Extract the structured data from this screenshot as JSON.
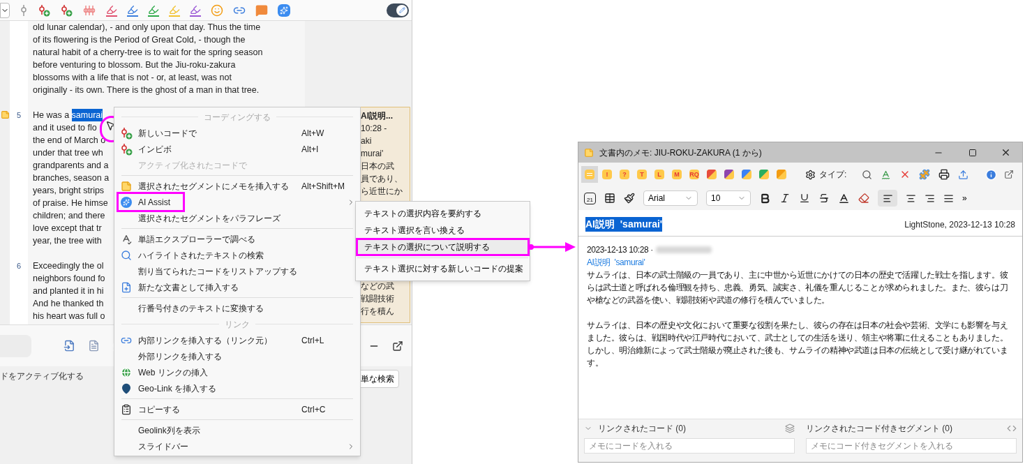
{
  "toolbar": {
    "tools": [
      {
        "kind": "dropdown"
      },
      {
        "kind": "pin"
      },
      {
        "kind": "code-add"
      },
      {
        "kind": "code-add"
      },
      {
        "kind": "codes"
      },
      {
        "kind": "marker",
        "color": "#e0506e"
      },
      {
        "kind": "marker",
        "color": "#3b7ddd"
      },
      {
        "kind": "marker",
        "color": "#2eaa4a"
      },
      {
        "kind": "marker",
        "color": "#f2c230"
      },
      {
        "kind": "marker",
        "color": "#9b59d6"
      },
      {
        "kind": "emoji"
      },
      {
        "kind": "link"
      },
      {
        "kind": "comment"
      },
      {
        "kind": "ai"
      }
    ],
    "edit_mode": {
      "on": true
    }
  },
  "document": {
    "paragraphs": [
      {
        "lines": [
          "old lunar calendar), - and only upon that day. Thus the time",
          "of its flowering is the Period of Great Cold, - though the",
          "natural habit of a cherry-tree is to wait for the spring season",
          "before venturing to blossom. But the Jiu-roku-zakura",
          "blossoms with a life that is not - or, at least, was not",
          "originally - its own. There is the ghost of a man in that tree."
        ]
      },
      {
        "number": "5",
        "lines": [
          [
            {
              "text": "He was a ",
              "selected": false
            },
            {
              "text": "samurai",
              "selected": true
            }
          ],
          "and it used to flo",
          "the end of March o",
          "under that tree wh",
          "grandparents and a",
          "branches, season a",
          "years, bright strips",
          "of praise. He himse",
          "children; and there",
          "love except that tr",
          "year, the tree with"
        ],
        "memo": true
      },
      {
        "number": "6",
        "lines": [
          "Exceedingly the ol",
          "neighbors found fo",
          "and planted it in hi",
          "And he thanked th",
          "his heart was full o"
        ]
      }
    ],
    "memo_strip": {
      "title": "AI説明...",
      "lines_top": [
        "10:28 -",
        "aki",
        "murai'",
        "日本の武",
        "員であり、",
        "ら近世にか"
      ],
      "lines_bottom": [
        "などの武",
        "戦闘技術",
        "行を積ん"
      ]
    }
  },
  "bottom_panel": {
    "tools": [
      {
        "kind": "import"
      },
      {
        "kind": "favorite"
      },
      {
        "kind": "comment"
      }
    ],
    "label": "ドをアクティブ化する",
    "button": "単な検索"
  },
  "context_menu": {
    "items": [
      {
        "kind": "header",
        "label": "コーディングする"
      },
      {
        "kind": "item",
        "label": "新しいコードで",
        "shortcut": "Alt+W",
        "disabled": false,
        "submenu": false,
        "annotated": false
      },
      {
        "kind": "item",
        "label": "インビボ",
        "shortcut": "Alt+I",
        "disabled": false,
        "submenu": false,
        "annotated": false
      },
      {
        "kind": "item",
        "label": "アクティブ化されたコードで",
        "disabled": true,
        "submenu": false,
        "annotated": false
      },
      {
        "kind": "separator"
      },
      {
        "kind": "item",
        "label": "選択されたセグメントにメモを挿入する",
        "shortcut": "Alt+Shift+M",
        "disabled": false,
        "submenu": false,
        "annotated": false
      },
      {
        "kind": "item",
        "label": "AI Assist",
        "disabled": false,
        "submenu": true,
        "annotated": true
      },
      {
        "kind": "item",
        "label": "選択されたセグメントをパラフレーズ",
        "disabled": false,
        "submenu": false,
        "annotated": false
      },
      {
        "kind": "separator"
      },
      {
        "kind": "item",
        "label": "単語エクスプローラーで調べる",
        "disabled": false,
        "submenu": false,
        "annotated": false
      },
      {
        "kind": "item",
        "label": "ハイライトされたテキストの検索",
        "disabled": false,
        "submenu": false,
        "annotated": false
      },
      {
        "kind": "item",
        "label": "割り当てられたコードをリストアップする",
        "disabled": false,
        "submenu": false,
        "annotated": false
      },
      {
        "kind": "item",
        "label": "新たな文書として挿入する",
        "disabled": false,
        "submenu": false,
        "annotated": false
      },
      {
        "kind": "separator"
      },
      {
        "kind": "item",
        "label": "行番号付きのテキストに変換する",
        "disabled": false,
        "submenu": false,
        "annotated": false
      },
      {
        "kind": "header",
        "label": "リンク"
      },
      {
        "kind": "item",
        "label": "内部リンクを挿入する（リンク元）",
        "shortcut": "Ctrl+L",
        "disabled": false,
        "submenu": false,
        "annotated": false
      },
      {
        "kind": "item",
        "label": "外部リンクを挿入する",
        "disabled": false,
        "submenu": false,
        "annotated": false
      },
      {
        "kind": "item",
        "label": "Web リンクの挿入",
        "disabled": false,
        "submenu": false,
        "annotated": false
      },
      {
        "kind": "item",
        "label": "Geo-Link を挿入する",
        "disabled": false,
        "submenu": false,
        "annotated": false
      },
      {
        "kind": "separator"
      },
      {
        "kind": "item",
        "label": "コピーする",
        "shortcut": "Ctrl+C",
        "disabled": false,
        "submenu": false,
        "annotated": false
      },
      {
        "kind": "separator"
      },
      {
        "kind": "item",
        "label": "Geolink列を表示",
        "disabled": false,
        "submenu": false,
        "annotated": false
      },
      {
        "kind": "item",
        "label": "スライドバー",
        "disabled": false,
        "submenu": true,
        "annotated": false
      }
    ]
  },
  "submenu": {
    "items": [
      {
        "kind": "item",
        "label": "テキストの選択内容を要約する",
        "selected": false,
        "annotated": false
      },
      {
        "kind": "item",
        "label": "テキスト選択を言い換える",
        "selected": false,
        "annotated": false
      },
      {
        "kind": "item",
        "label": "テキストの選択について説明する",
        "selected": true,
        "annotated": true
      },
      {
        "kind": "separator"
      },
      {
        "kind": "item",
        "label": "テキスト選択に対する新しいコードの提案",
        "selected": false,
        "annotated": false
      }
    ]
  },
  "memo_window": {
    "title": "文書内のメモ: JIU-ROKU-ZAKURA (1 から)",
    "memo_types": [
      {
        "kind": "plain",
        "selected": true
      },
      {
        "kind": "letter",
        "label": "!",
        "selected": false
      },
      {
        "kind": "letter",
        "label": "?",
        "selected": false
      },
      {
        "kind": "letter",
        "label": "T",
        "selected": false
      },
      {
        "kind": "letter",
        "label": "L",
        "selected": false
      },
      {
        "kind": "letter",
        "label": "M",
        "selected": false
      },
      {
        "kind": "letter",
        "label": "RQ",
        "selected": false
      },
      {
        "kind": "corner",
        "color": "#e74c3c",
        "selected": false
      },
      {
        "kind": "corner",
        "color": "#8e44ad",
        "selected": false
      },
      {
        "kind": "corner",
        "color": "#3b82f6",
        "selected": false
      },
      {
        "kind": "corner",
        "color": "#27ae60",
        "selected": false
      },
      {
        "kind": "corner",
        "color": "#f39c12",
        "selected": false
      }
    ],
    "type_label": "タイプ:",
    "calendar_day": "21",
    "font": "Arial",
    "font_size": "10",
    "more": "»",
    "memo_title": "AI説明  'samurai'",
    "memo_title_selected": true,
    "meta": "LightStone, 2023-12-13 10:28",
    "date_line": "2023-12-13 10:28 ·",
    "subtitle": "AI説明  'samurai'",
    "paragraphs": [
      "サムライは、日本の武士階級の一員であり、主に中世から近世にかけての日本の歴史で活躍した戦士を指します。彼らは武士道と呼ばれる倫理観を持ち、忠義、勇気、誠実さ、礼儀を重んじることが求められました。また、彼らは刀や槍などの武器を使い、戦闘技術や武道の修行を積んでいました。",
      "サムライは、日本の歴史や文化において重要な役割を果たし、彼らの存在は日本の社会や芸術、文学にも影響を与えました。彼らは、戦国時代や江戸時代において、武士としての生活を送り、領主や将軍に仕えることもありました。しかし、明治維新によって武士階級が廃止された後も、サムライの精神や武道は日本の伝統として受け継がれています。"
    ],
    "linked_codes": {
      "label": "リンクされたコード (0)",
      "placeholder": "メモにコードを入れる"
    },
    "linked_segments": {
      "label": "リンクされたコード付きセグメント (0)",
      "placeholder": "メモにコード付きセグメントを入れる"
    }
  }
}
